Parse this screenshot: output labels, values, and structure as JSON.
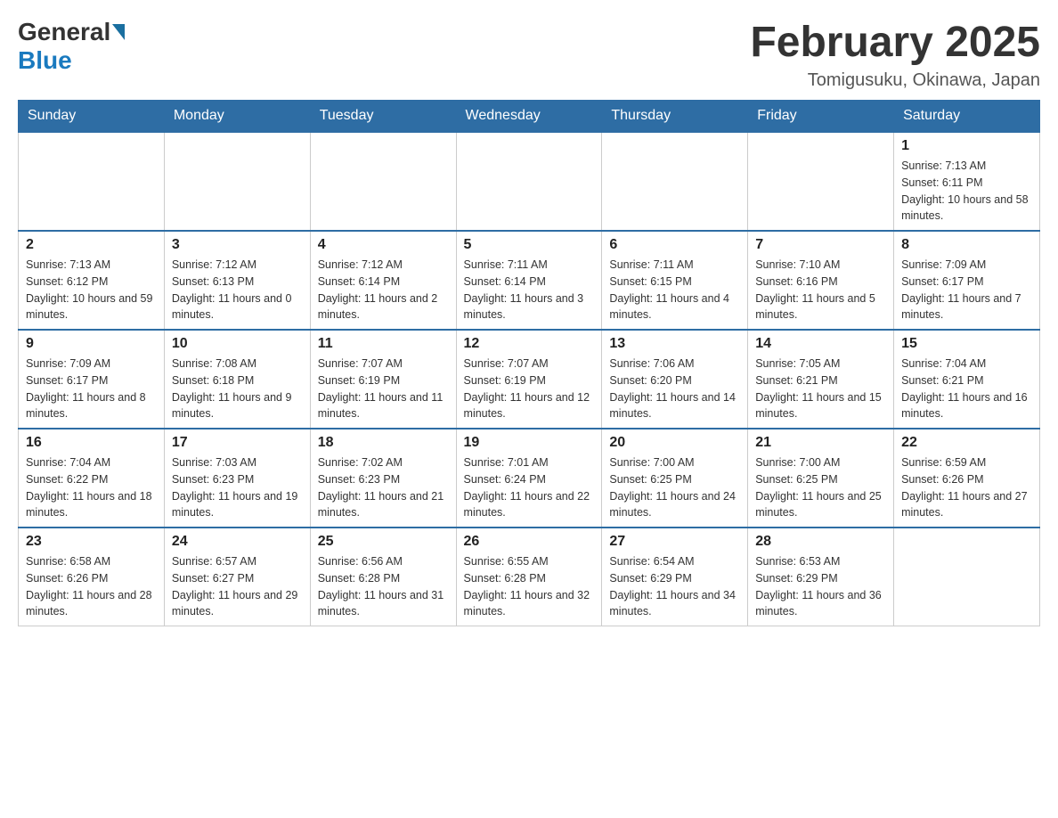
{
  "header": {
    "logo_general": "General",
    "logo_blue": "Blue",
    "month_title": "February 2025",
    "location": "Tomigusuku, Okinawa, Japan"
  },
  "weekdays": [
    "Sunday",
    "Monday",
    "Tuesday",
    "Wednesday",
    "Thursday",
    "Friday",
    "Saturday"
  ],
  "weeks": [
    [
      {
        "day": "",
        "sunrise": "",
        "sunset": "",
        "daylight": ""
      },
      {
        "day": "",
        "sunrise": "",
        "sunset": "",
        "daylight": ""
      },
      {
        "day": "",
        "sunrise": "",
        "sunset": "",
        "daylight": ""
      },
      {
        "day": "",
        "sunrise": "",
        "sunset": "",
        "daylight": ""
      },
      {
        "day": "",
        "sunrise": "",
        "sunset": "",
        "daylight": ""
      },
      {
        "day": "",
        "sunrise": "",
        "sunset": "",
        "daylight": ""
      },
      {
        "day": "1",
        "sunrise": "Sunrise: 7:13 AM",
        "sunset": "Sunset: 6:11 PM",
        "daylight": "Daylight: 10 hours and 58 minutes."
      }
    ],
    [
      {
        "day": "2",
        "sunrise": "Sunrise: 7:13 AM",
        "sunset": "Sunset: 6:12 PM",
        "daylight": "Daylight: 10 hours and 59 minutes."
      },
      {
        "day": "3",
        "sunrise": "Sunrise: 7:12 AM",
        "sunset": "Sunset: 6:13 PM",
        "daylight": "Daylight: 11 hours and 0 minutes."
      },
      {
        "day": "4",
        "sunrise": "Sunrise: 7:12 AM",
        "sunset": "Sunset: 6:14 PM",
        "daylight": "Daylight: 11 hours and 2 minutes."
      },
      {
        "day": "5",
        "sunrise": "Sunrise: 7:11 AM",
        "sunset": "Sunset: 6:14 PM",
        "daylight": "Daylight: 11 hours and 3 minutes."
      },
      {
        "day": "6",
        "sunrise": "Sunrise: 7:11 AM",
        "sunset": "Sunset: 6:15 PM",
        "daylight": "Daylight: 11 hours and 4 minutes."
      },
      {
        "day": "7",
        "sunrise": "Sunrise: 7:10 AM",
        "sunset": "Sunset: 6:16 PM",
        "daylight": "Daylight: 11 hours and 5 minutes."
      },
      {
        "day": "8",
        "sunrise": "Sunrise: 7:09 AM",
        "sunset": "Sunset: 6:17 PM",
        "daylight": "Daylight: 11 hours and 7 minutes."
      }
    ],
    [
      {
        "day": "9",
        "sunrise": "Sunrise: 7:09 AM",
        "sunset": "Sunset: 6:17 PM",
        "daylight": "Daylight: 11 hours and 8 minutes."
      },
      {
        "day": "10",
        "sunrise": "Sunrise: 7:08 AM",
        "sunset": "Sunset: 6:18 PM",
        "daylight": "Daylight: 11 hours and 9 minutes."
      },
      {
        "day": "11",
        "sunrise": "Sunrise: 7:07 AM",
        "sunset": "Sunset: 6:19 PM",
        "daylight": "Daylight: 11 hours and 11 minutes."
      },
      {
        "day": "12",
        "sunrise": "Sunrise: 7:07 AM",
        "sunset": "Sunset: 6:19 PM",
        "daylight": "Daylight: 11 hours and 12 minutes."
      },
      {
        "day": "13",
        "sunrise": "Sunrise: 7:06 AM",
        "sunset": "Sunset: 6:20 PM",
        "daylight": "Daylight: 11 hours and 14 minutes."
      },
      {
        "day": "14",
        "sunrise": "Sunrise: 7:05 AM",
        "sunset": "Sunset: 6:21 PM",
        "daylight": "Daylight: 11 hours and 15 minutes."
      },
      {
        "day": "15",
        "sunrise": "Sunrise: 7:04 AM",
        "sunset": "Sunset: 6:21 PM",
        "daylight": "Daylight: 11 hours and 16 minutes."
      }
    ],
    [
      {
        "day": "16",
        "sunrise": "Sunrise: 7:04 AM",
        "sunset": "Sunset: 6:22 PM",
        "daylight": "Daylight: 11 hours and 18 minutes."
      },
      {
        "day": "17",
        "sunrise": "Sunrise: 7:03 AM",
        "sunset": "Sunset: 6:23 PM",
        "daylight": "Daylight: 11 hours and 19 minutes."
      },
      {
        "day": "18",
        "sunrise": "Sunrise: 7:02 AM",
        "sunset": "Sunset: 6:23 PM",
        "daylight": "Daylight: 11 hours and 21 minutes."
      },
      {
        "day": "19",
        "sunrise": "Sunrise: 7:01 AM",
        "sunset": "Sunset: 6:24 PM",
        "daylight": "Daylight: 11 hours and 22 minutes."
      },
      {
        "day": "20",
        "sunrise": "Sunrise: 7:00 AM",
        "sunset": "Sunset: 6:25 PM",
        "daylight": "Daylight: 11 hours and 24 minutes."
      },
      {
        "day": "21",
        "sunrise": "Sunrise: 7:00 AM",
        "sunset": "Sunset: 6:25 PM",
        "daylight": "Daylight: 11 hours and 25 minutes."
      },
      {
        "day": "22",
        "sunrise": "Sunrise: 6:59 AM",
        "sunset": "Sunset: 6:26 PM",
        "daylight": "Daylight: 11 hours and 27 minutes."
      }
    ],
    [
      {
        "day": "23",
        "sunrise": "Sunrise: 6:58 AM",
        "sunset": "Sunset: 6:26 PM",
        "daylight": "Daylight: 11 hours and 28 minutes."
      },
      {
        "day": "24",
        "sunrise": "Sunrise: 6:57 AM",
        "sunset": "Sunset: 6:27 PM",
        "daylight": "Daylight: 11 hours and 29 minutes."
      },
      {
        "day": "25",
        "sunrise": "Sunrise: 6:56 AM",
        "sunset": "Sunset: 6:28 PM",
        "daylight": "Daylight: 11 hours and 31 minutes."
      },
      {
        "day": "26",
        "sunrise": "Sunrise: 6:55 AM",
        "sunset": "Sunset: 6:28 PM",
        "daylight": "Daylight: 11 hours and 32 minutes."
      },
      {
        "day": "27",
        "sunrise": "Sunrise: 6:54 AM",
        "sunset": "Sunset: 6:29 PM",
        "daylight": "Daylight: 11 hours and 34 minutes."
      },
      {
        "day": "28",
        "sunrise": "Sunrise: 6:53 AM",
        "sunset": "Sunset: 6:29 PM",
        "daylight": "Daylight: 11 hours and 36 minutes."
      },
      {
        "day": "",
        "sunrise": "",
        "sunset": "",
        "daylight": ""
      }
    ]
  ]
}
